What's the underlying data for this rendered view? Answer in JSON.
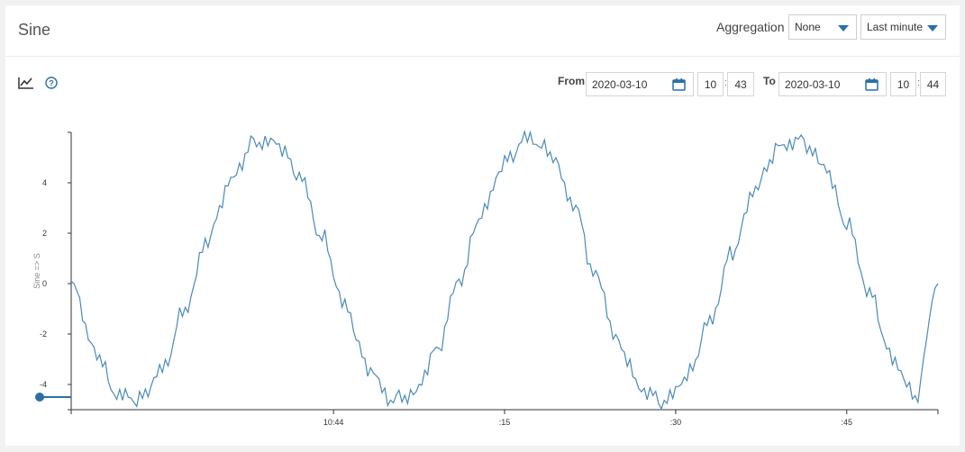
{
  "panel": {
    "title": "Sine",
    "aggregation_label": "Aggregation",
    "aggregation_value": "None",
    "range_value": "Last minute"
  },
  "toolbar": {
    "chart_icon": "line-chart-icon",
    "help_icon": "help-circle-icon",
    "from_label": "From",
    "from_date": "2020-03-10",
    "from_hour": "10",
    "from_minute": "43",
    "to_label": "To",
    "to_date": "2020-03-10",
    "to_hour": "10",
    "to_minute": "44",
    "time_separator": ":",
    "calendar_icon": "calendar-icon"
  },
  "colors": {
    "line": "#4a8ab8",
    "accent": "#2a6fa8",
    "axis": "#333333"
  },
  "chart_data": {
    "type": "line",
    "title": "",
    "xlabel": "",
    "ylabel": "Sine => S",
    "ylim": [
      -5,
      6
    ],
    "yticks": [
      -4,
      -2,
      0,
      2,
      4
    ],
    "xlim": [
      "10:43:37",
      "10:44:53"
    ],
    "xticks": [
      {
        "t": "10:44:00",
        "label": "10:44"
      },
      {
        "t": "10:44:15",
        "label": ":15"
      },
      {
        "t": "10:44:30",
        "label": ":30"
      },
      {
        "t": "10:44:45",
        "label": ":45"
      }
    ],
    "grid": false,
    "series": [
      {
        "x": [
          "10:43:37",
          "10:43:39",
          "10:43:41",
          "10:43:43",
          "10:43:45",
          "10:43:47",
          "10:43:49",
          "10:43:51",
          "10:43:53",
          "10:43:55",
          "10:43:57",
          "10:43:59",
          "10:44:01",
          "10:44:03",
          "10:44:05",
          "10:44:07",
          "10:44:09",
          "10:44:11",
          "10:44:13",
          "10:44:15",
          "10:44:17",
          "10:44:19",
          "10:44:21",
          "10:44:23",
          "10:44:25",
          "10:44:27",
          "10:44:29",
          "10:44:31",
          "10:44:33",
          "10:44:35",
          "10:44:37",
          "10:44:39",
          "10:44:41",
          "10:44:43",
          "10:44:45",
          "10:44:47",
          "10:44:49",
          "10:44:51",
          "10:44:53"
        ],
        "y": [
          0.1,
          -2.6,
          -4.4,
          -4.6,
          -3.4,
          -1.0,
          1.8,
          4.1,
          5.6,
          5.6,
          4.3,
          1.8,
          -0.9,
          -3.3,
          -4.6,
          -4.4,
          -2.7,
          0.1,
          2.8,
          4.8,
          5.8,
          5.2,
          3.2,
          0.3,
          -2.4,
          -4.2,
          -4.7,
          -3.7,
          -1.5,
          1.3,
          3.8,
          5.4,
          5.7,
          4.7,
          2.4,
          -0.4,
          -3.0,
          -4.5,
          0.0
        ]
      }
    ]
  }
}
